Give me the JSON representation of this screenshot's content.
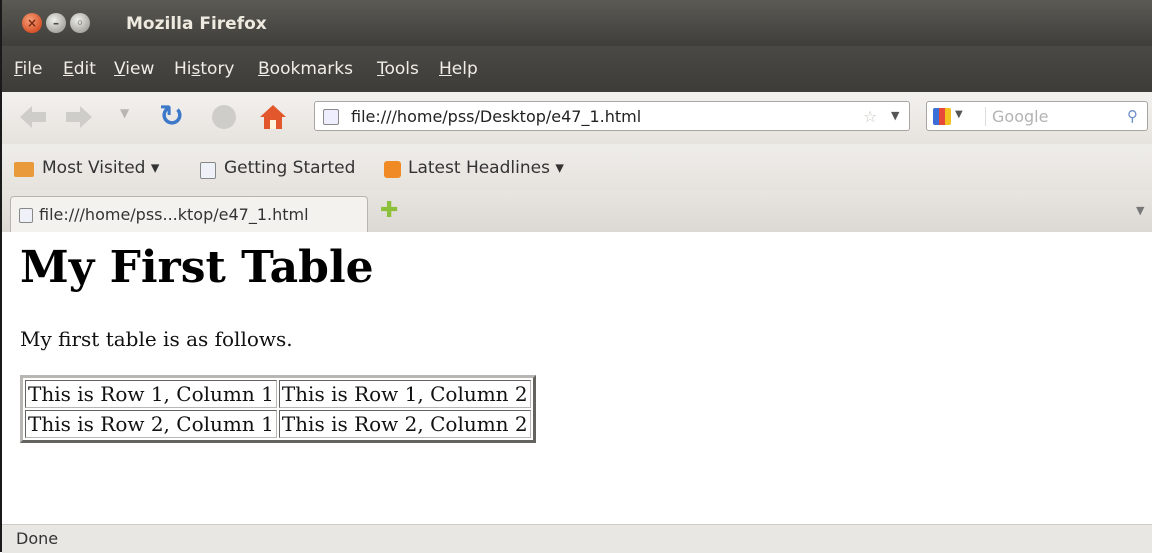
{
  "window": {
    "title": "Mozilla Firefox",
    "buttons": {
      "close": "×",
      "minimize": "–",
      "maximize": "◦"
    }
  },
  "menu": [
    {
      "accel": "F",
      "rest": "ile"
    },
    {
      "accel": "E",
      "rest": "dit"
    },
    {
      "accel": "V",
      "rest": "iew"
    },
    {
      "pre": "Hi",
      "accel": "s",
      "rest": "tory"
    },
    {
      "accel": "B",
      "rest": "ookmarks"
    },
    {
      "accel": "T",
      "rest": "ools"
    },
    {
      "accel": "H",
      "rest": "elp"
    }
  ],
  "nav": {
    "url": "file:///home/pss/Desktop/e47_1.html",
    "search_placeholder": "Google"
  },
  "bookmarks": {
    "most_visited": "Most Visited ▾",
    "getting_started": "Getting Started",
    "latest_headlines": "Latest Headlines ▾"
  },
  "tab": {
    "label": "file:///home/pss...ktop/e47_1.html"
  },
  "page": {
    "heading": "My First Table",
    "paragraph": "My first table is as follows.",
    "table": [
      [
        "This is Row 1, Column 1",
        "This is Row 1, Column 2"
      ],
      [
        "This is Row 2, Column 1",
        "This is Row 2, Column 2"
      ]
    ]
  },
  "status": "Done",
  "icons": [
    "close-icon",
    "minimize-icon",
    "maximize-icon",
    "back-icon",
    "forward-icon",
    "reload-icon",
    "stop-icon",
    "home-icon",
    "favicon-icon",
    "bookmark-star-icon",
    "search-engine-icon",
    "search-icon",
    "folder-icon",
    "rss-icon",
    "new-tab-icon",
    "tab-list-icon"
  ]
}
